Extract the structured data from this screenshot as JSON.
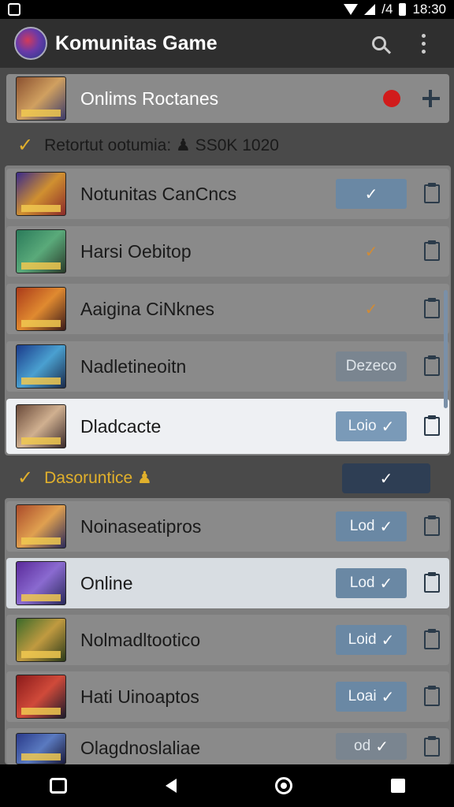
{
  "status_bar": {
    "time": "18:30",
    "signal_text": "/4"
  },
  "app_bar": {
    "title": "Komunitas Game"
  },
  "online_card": {
    "label": "Onlims Roctanes"
  },
  "section1": {
    "title": "Retortut ootumia: ♟ SS0K 1020"
  },
  "section1_items": [
    {
      "label": "Notunitas CanCncs",
      "pill": ""
    },
    {
      "label": "Harsi Oebitop",
      "pill": ""
    },
    {
      "label": "Aaigina CiNknes",
      "pill": ""
    },
    {
      "label": "Nadletineoitn",
      "pill": "Dezeco"
    },
    {
      "label": "Dladcacte",
      "pill": "Loio"
    }
  ],
  "section2": {
    "title": "Dasoruntice ♟"
  },
  "section2_items": [
    {
      "label": "Noinaseatipros",
      "pill": "Lod"
    },
    {
      "label": "Online",
      "pill": "Lod"
    },
    {
      "label": "Nolmadltootico",
      "pill": "Loid"
    },
    {
      "label": "Hati Uinoaptos",
      "pill": "Loai"
    },
    {
      "label": "Olagdnoslaliae",
      "pill": "od"
    }
  ],
  "icons": {
    "check": "✓",
    "section_check": "✓"
  },
  "colors": {
    "accent_yellow": "#e1b02c",
    "pill_blue": "#6a88a4",
    "appbar": "#2f2f2f"
  }
}
